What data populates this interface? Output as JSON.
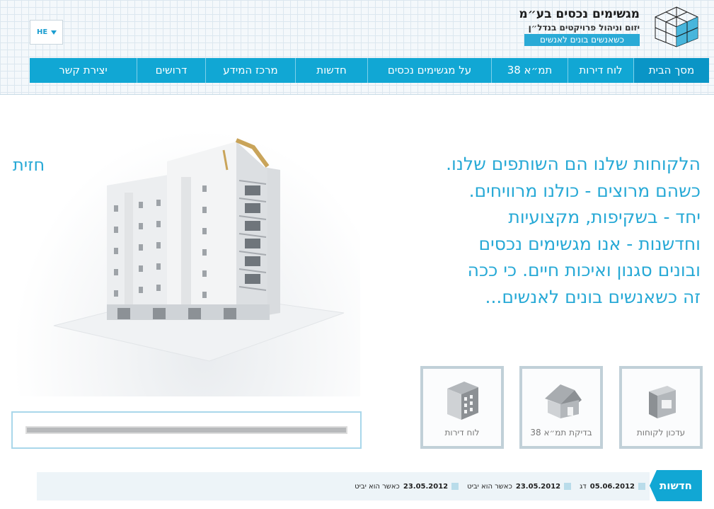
{
  "header": {
    "logo_title": "מגשימים נכסים בע״מ",
    "logo_subtitle": "יזום וניהול פרויקטים בנדל״ן",
    "logo_tagline": "כשאנשים בונים לאנשים",
    "language": "HE"
  },
  "nav": {
    "items": [
      {
        "label": "מסך הבית",
        "active": true
      },
      {
        "label": "לוח דירות"
      },
      {
        "label": "תמ״א 38"
      },
      {
        "label": "על מגשימים נכסים"
      },
      {
        "label": "חדשות"
      },
      {
        "label": "מרכז המידע"
      },
      {
        "label": "דרושים"
      },
      {
        "label": "יצירת קשר"
      }
    ]
  },
  "main": {
    "vision_label": "חזית",
    "slogan_lines": [
      "הלקוחות שלנו הם השותפים שלנו.",
      "כשהם מרוצים - כולנו מרוויחים.",
      "יחד - בשקיפות, מקצועיות",
      "וחדשנות - אנו מגשימים נכסים",
      "ובונים סגנון ואיכות חיים. כי ככה",
      "זה כשאנשים בונים לאנשים..."
    ],
    "tiles": [
      {
        "label": "עדכון לקוחות",
        "icon": "mailbox-icon"
      },
      {
        "label": "בדיקת תמ״א 38",
        "icon": "house-icon"
      },
      {
        "label": "לוח דירות",
        "icon": "building-icon"
      }
    ]
  },
  "news": {
    "tab_label": "חדשות",
    "items": [
      {
        "date": "05.06.2012",
        "text": "דג"
      },
      {
        "date": "23.05.2012",
        "text": "כאשר הוא יביט"
      },
      {
        "date": "23.05.2012",
        "text": "כאשר הוא יביט"
      }
    ]
  },
  "colors": {
    "accent": "#11a7d4",
    "slogan": "#27a9d6",
    "tile_border": "#c1d0d8"
  }
}
